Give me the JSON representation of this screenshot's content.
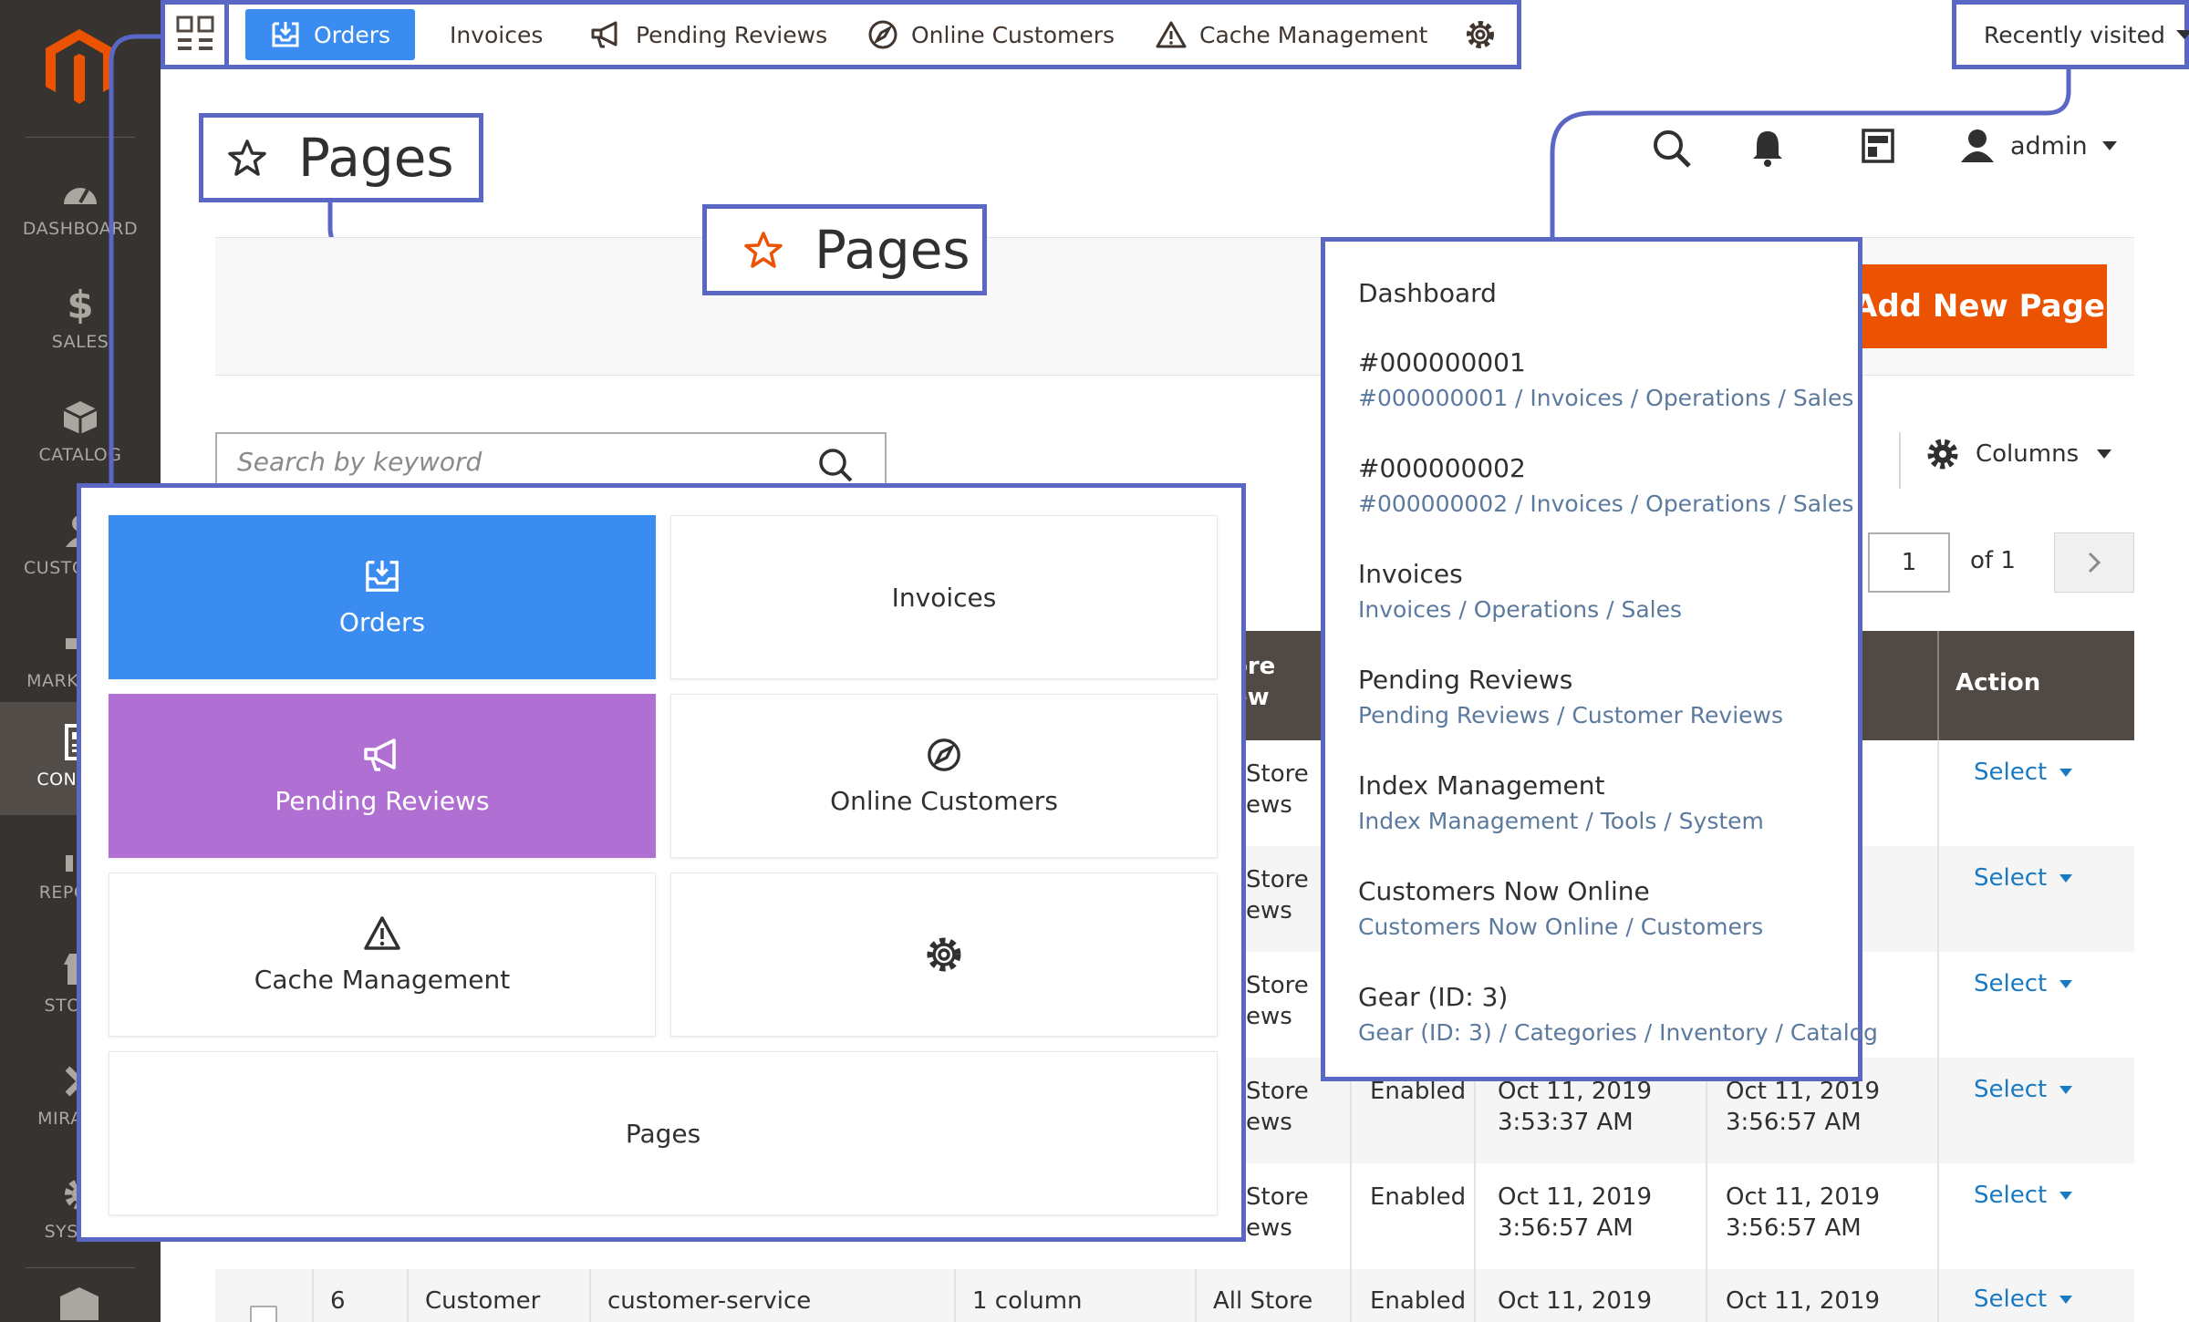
{
  "sidebar": {
    "items": [
      {
        "label": "DASHBOARD",
        "icon": "dashboard-icon"
      },
      {
        "label": "SALES",
        "icon": "dollar-icon"
      },
      {
        "label": "CATALOG",
        "icon": "cube-icon"
      },
      {
        "label": "CUSTOMERS",
        "icon": "person-icon"
      },
      {
        "label": "MARKETING",
        "icon": "megaphone-icon"
      },
      {
        "label": "CONTENT",
        "icon": "content-icon"
      },
      {
        "label": "REPORTS",
        "icon": "bar-chart-icon"
      },
      {
        "label": "STORES",
        "icon": "store-icon"
      },
      {
        "label": "MIRASVIT",
        "icon": "tools-icon"
      },
      {
        "label": "SYSTEM",
        "icon": "gear-icon"
      }
    ]
  },
  "topnav": {
    "items": [
      {
        "label": "Orders",
        "icon": "inbox-icon",
        "active": true
      },
      {
        "label": "Invoices"
      },
      {
        "label": "Pending Reviews",
        "icon": "megaphone-icon"
      },
      {
        "label": "Online Customers",
        "icon": "compass-icon"
      },
      {
        "label": "Cache Management",
        "icon": "warning-icon"
      }
    ],
    "recently_visited": "Recently visited"
  },
  "header": {
    "page_title": "Pages",
    "page_title_alt": "Pages",
    "user": "admin",
    "add_button": "Add New Page"
  },
  "toolbar": {
    "search_placeholder": "Search by keyword",
    "columns_label": "Columns",
    "page_current": "1",
    "page_of": "of 1"
  },
  "table": {
    "headers": {
      "store_view_a": "ore",
      "store_view_b": "ew",
      "action": "Action"
    },
    "rows": [
      {
        "store_a": "Store",
        "store_b": "ews",
        "status": "",
        "created_a": "",
        "created_b": "",
        "modified_a": "",
        "modified_b": "",
        "action": "Select"
      },
      {
        "store_a": "Store",
        "store_b": "ews",
        "status": "",
        "created_a": "",
        "created_b": "",
        "modified_a": "",
        "modified_b": "",
        "action": "Select"
      },
      {
        "store_a": "Store",
        "store_b": "ews",
        "status": "",
        "created_a": "",
        "created_b": "",
        "modified_a": "",
        "modified_b": "",
        "action": "Select"
      },
      {
        "store_a": "Store",
        "store_b": "ews",
        "status": "Enabled",
        "created_a": "Oct 11, 2019",
        "created_b": "3:53:37 AM",
        "modified_a": "Oct 11, 2019",
        "modified_b": "3:56:57 AM",
        "action": "Select"
      },
      {
        "store_a": "Store",
        "store_b": "ews",
        "status": "Enabled",
        "created_a": "Oct 11, 2019",
        "created_b": "3:56:57 AM",
        "modified_a": "Oct 11, 2019",
        "modified_b": "3:56:57 AM",
        "action": "Select"
      }
    ],
    "last_row": {
      "id": "6",
      "title": "Customer",
      "url_key": "customer-service",
      "layout": "1 column",
      "store": "All Store",
      "status": "Enabled",
      "created": "Oct 11, 2019",
      "modified": "Oct 11, 2019",
      "action": "Select"
    }
  },
  "launcher": {
    "tiles": [
      {
        "label": "Orders",
        "icon": "inbox-icon"
      },
      {
        "label": "Invoices"
      },
      {
        "label": "Pending Reviews",
        "icon": "megaphone-icon"
      },
      {
        "label": "Online Customers",
        "icon": "compass-icon"
      },
      {
        "label": "Cache Management",
        "icon": "warning-icon"
      },
      {
        "label": "",
        "icon": "gear-icon"
      },
      {
        "label": "Pages"
      }
    ]
  },
  "recent": {
    "items": [
      {
        "title": "Dashboard",
        "path": ""
      },
      {
        "title": "#000000001",
        "path": "#000000001 / Invoices / Operations / Sales"
      },
      {
        "title": "#000000002",
        "path": "#000000002 / Invoices / Operations / Sales"
      },
      {
        "title": "Invoices",
        "path": "Invoices / Operations / Sales"
      },
      {
        "title": "Pending Reviews",
        "path": "Pending Reviews / Customer Reviews"
      },
      {
        "title": "Index Management",
        "path": "Index Management / Tools / System"
      },
      {
        "title": "Customers Now Online",
        "path": "Customers Now Online / Customers"
      },
      {
        "title": "Gear (ID: 3)",
        "path": "Gear (ID: 3) / Categories / Inventory / Catalog"
      }
    ]
  },
  "colors": {
    "accent": "#5b67c4",
    "orders_blue": "#3a8cf0",
    "reviews_purple": "#b06fd2",
    "add_orange": "#eb5202",
    "sidebar": "#373330",
    "table_head": "#514943",
    "link": "#1979c3"
  }
}
